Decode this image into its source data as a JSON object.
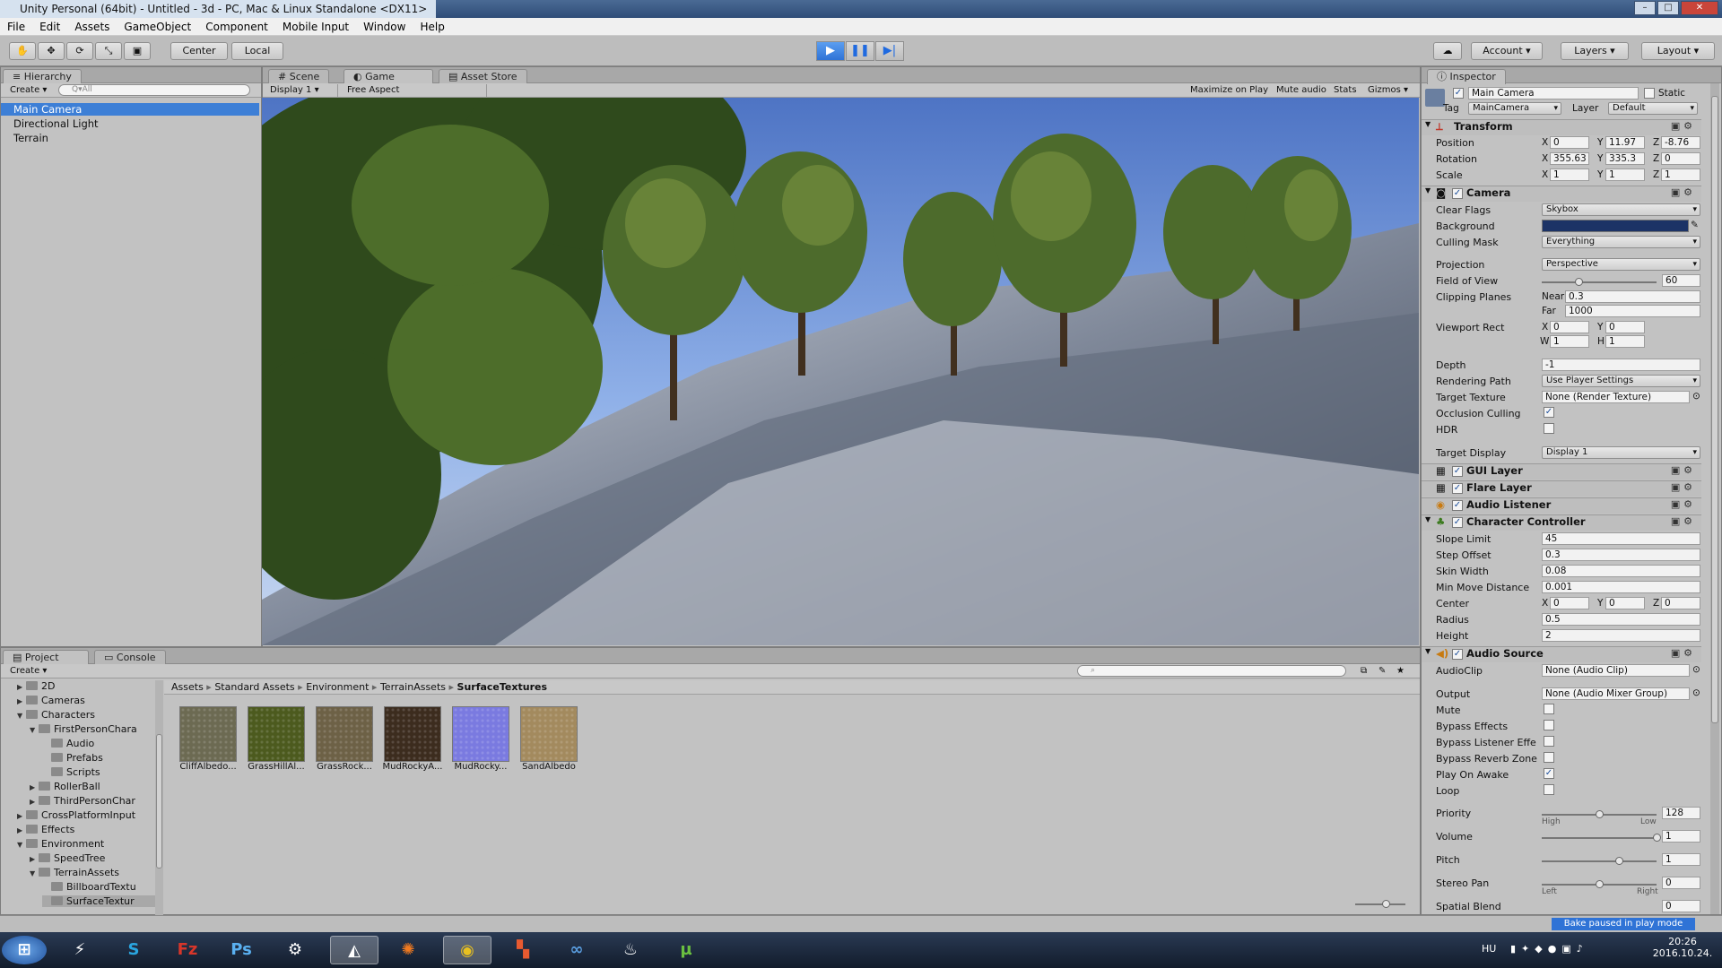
{
  "window": {
    "title": "Unity Personal (64bit) - Untitled - 3d - PC, Mac & Linux Standalone <DX11>"
  },
  "menu": [
    "File",
    "Edit",
    "Assets",
    "GameObject",
    "Component",
    "Mobile Input",
    "Window",
    "Help"
  ],
  "toolbar": {
    "center": "Center",
    "local": "Local",
    "account": "Account",
    "layers": "Layers",
    "layout": "Layout",
    "play_icon": "play-icon",
    "pause_icon": "pause-icon",
    "step_icon": "step-icon"
  },
  "hierarchy": {
    "tab": "Hierarchy",
    "create": "Create",
    "search_placeholder": "Q▾All",
    "items": [
      "Main Camera",
      "Directional Light",
      "Terrain"
    ]
  },
  "scene_tabs": {
    "scene": "Scene",
    "game": "Game",
    "store": "Asset Store"
  },
  "game_bar": {
    "display": "Display 1",
    "aspect": "Free Aspect",
    "maximize": "Maximize on Play",
    "mute": "Mute audio",
    "stats": "Stats",
    "gizmos": "Gizmos"
  },
  "project": {
    "tab": "Project",
    "console": "Console",
    "create": "Create",
    "tree": [
      {
        "label": "2D",
        "indent": 1,
        "arrow": "▶"
      },
      {
        "label": "Cameras",
        "indent": 1,
        "arrow": "▶"
      },
      {
        "label": "Characters",
        "indent": 1,
        "arrow": "▼"
      },
      {
        "label": "FirstPersonChara",
        "indent": 2,
        "arrow": "▼"
      },
      {
        "label": "Audio",
        "indent": 3,
        "arrow": ""
      },
      {
        "label": "Prefabs",
        "indent": 3,
        "arrow": ""
      },
      {
        "label": "Scripts",
        "indent": 3,
        "arrow": ""
      },
      {
        "label": "RollerBall",
        "indent": 2,
        "arrow": "▶"
      },
      {
        "label": "ThirdPersonChar",
        "indent": 2,
        "arrow": "▶"
      },
      {
        "label": "CrossPlatformInput",
        "indent": 1,
        "arrow": "▶"
      },
      {
        "label": "Effects",
        "indent": 1,
        "arrow": "▶"
      },
      {
        "label": "Environment",
        "indent": 1,
        "arrow": "▼"
      },
      {
        "label": "SpeedTree",
        "indent": 2,
        "arrow": "▶"
      },
      {
        "label": "TerrainAssets",
        "indent": 2,
        "arrow": "▼"
      },
      {
        "label": "BillboardTextu",
        "indent": 3,
        "arrow": ""
      },
      {
        "label": "SurfaceTextur",
        "indent": 3,
        "arrow": ""
      }
    ],
    "breadcrumb": [
      "Assets",
      "Standard Assets",
      "Environment",
      "TerrainAssets",
      "SurfaceTextures"
    ],
    "assets": [
      {
        "name": "CliffAlbedo...",
        "color": "#6c6a52"
      },
      {
        "name": "GrassHillAl...",
        "color": "#4c5a1e"
      },
      {
        "name": "GrassRock...",
        "color": "#6d6146"
      },
      {
        "name": "MudRockyA...",
        "color": "#3c2c1e"
      },
      {
        "name": "MudRocky...",
        "color": "#7a7ae0"
      },
      {
        "name": "SandAlbedo",
        "color": "#a38a5e"
      }
    ]
  },
  "inspector": {
    "tab": "Inspector",
    "object_name": "Main Camera",
    "static": "Static",
    "tag_label": "Tag",
    "tag": "MainCamera",
    "layer_label": "Layer",
    "layer": "Default",
    "transform": {
      "title": "Transform",
      "position": {
        "label": "Position",
        "x": "0",
        "y": "11.97",
        "z": "-8.76"
      },
      "rotation": {
        "label": "Rotation",
        "x": "355.63",
        "y": "335.3",
        "z": "0"
      },
      "scale": {
        "label": "Scale",
        "x": "1",
        "y": "1",
        "z": "1"
      }
    },
    "camera": {
      "title": "Camera",
      "clear_flags_label": "Clear Flags",
      "clear_flags": "Skybox",
      "background_label": "Background",
      "background_color": "#1c3366",
      "culling_label": "Culling Mask",
      "culling": "Everything",
      "projection_label": "Projection",
      "projection": "Perspective",
      "fov_label": "Field of View",
      "fov": "60",
      "fov_fraction": 0.32,
      "clip_label": "Clipping Planes",
      "near_label": "Near",
      "near": "0.3",
      "far_label": "Far",
      "far": "1000",
      "viewport_label": "Viewport Rect",
      "vx": "0",
      "vy": "0",
      "vw": "1",
      "vh": "1",
      "depth_label": "Depth",
      "depth": "-1",
      "render_path_label": "Rendering Path",
      "render_path": "Use Player Settings",
      "target_tex_label": "Target Texture",
      "target_tex": "None (Render Texture)",
      "occlusion_label": "Occlusion Culling",
      "hdr_label": "HDR",
      "target_display_label": "Target Display",
      "target_display": "Display 1"
    },
    "gui_layer": "GUI Layer",
    "flare_layer": "Flare Layer",
    "audio_listener": "Audio Listener",
    "char_ctrl": {
      "title": "Character Controller",
      "slope_label": "Slope Limit",
      "slope": "45",
      "step_label": "Step Offset",
      "step": "0.3",
      "skin_label": "Skin Width",
      "skin": "0.08",
      "minmove_label": "Min Move Distance",
      "minmove": "0.001",
      "center_label": "Center",
      "cx": "0",
      "cy": "0",
      "cz": "0",
      "radius_label": "Radius",
      "radius": "0.5",
      "height_label": "Height",
      "height": "2"
    },
    "audio_source": {
      "title": "Audio Source",
      "clip_label": "AudioClip",
      "clip": "None (Audio Clip)",
      "output_label": "Output",
      "output": "None (Audio Mixer Group)",
      "mute_label": "Mute",
      "bypass_label": "Bypass Effects",
      "bypass_listener_label": "Bypass Listener Effe",
      "bypass_reverb_label": "Bypass Reverb Zone",
      "play_awake_label": "Play On Awake",
      "loop_label": "Loop",
      "priority_label": "Priority",
      "priority": "128",
      "priority_fraction": 0.5,
      "high": "High",
      "low": "Low",
      "volume_label": "Volume",
      "volume": "1",
      "volume_fraction": 1.0,
      "pitch_label": "Pitch",
      "pitch": "1",
      "pitch_fraction": 0.67,
      "stereo_label": "Stereo Pan",
      "stereo": "0",
      "stereo_fraction": 0.5,
      "left": "Left",
      "right": "Right",
      "spatial_label": "Spatial Blend",
      "spatial": "0"
    }
  },
  "status": {
    "bake": "Bake paused in play mode"
  },
  "tray": {
    "lang": "HU",
    "time": "20:26",
    "date": "2016.10.24."
  }
}
